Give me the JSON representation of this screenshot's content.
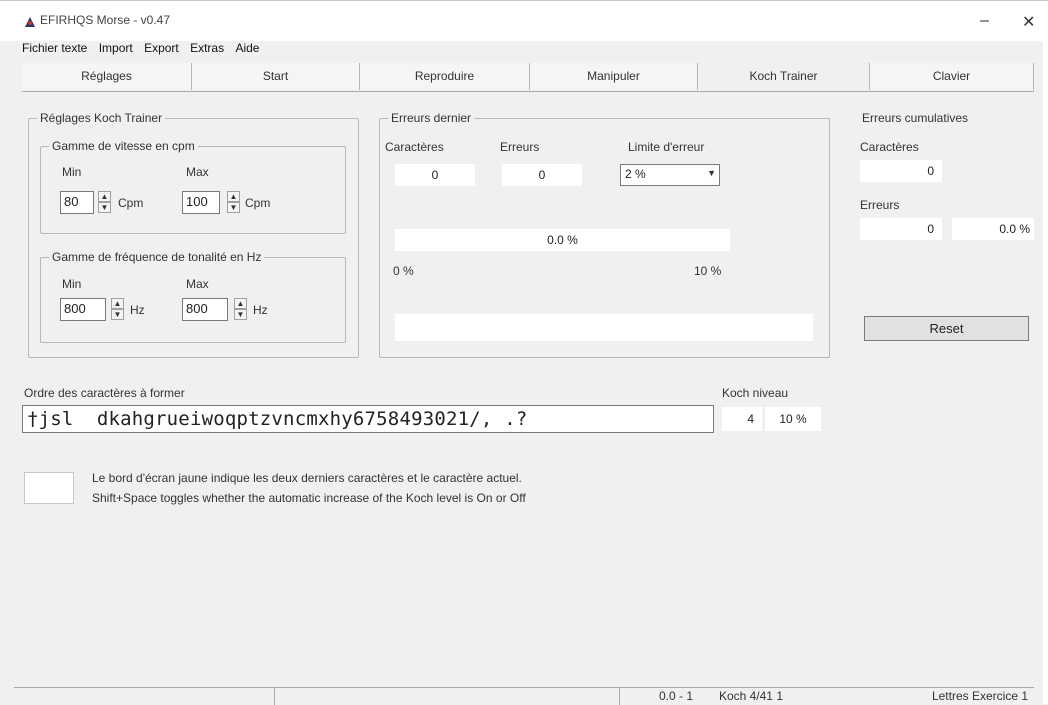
{
  "window": {
    "title": "EFIRHQS Morse - v0.47",
    "minimize": "‒",
    "close": "✕"
  },
  "menu": [
    "Fichier texte",
    "Import",
    "Export",
    "Extras",
    "Aide"
  ],
  "tabs": [
    "Réglages",
    "Start",
    "Reproduire",
    "Manipuler",
    "Koch Trainer",
    "Clavier"
  ],
  "koch_settings": {
    "title": "Réglages Koch Trainer",
    "speed_group": "Gamme de vitesse en cpm",
    "min_label": "Min",
    "max_label": "Max",
    "speed_min": "80",
    "speed_max": "100",
    "speed_unit": "Cpm",
    "freq_group": "Gamme de fréquence de tonalité en Hz",
    "freq_min": "800",
    "freq_max": "800",
    "freq_unit": "Hz"
  },
  "last_errors": {
    "title": "Erreurs dernier",
    "chars_label": "Caractères",
    "errors_label": "Erreurs",
    "limit_label": "Limite d'erreur",
    "chars_value": "0",
    "errors_value": "0",
    "limit_value": "2 %",
    "progress_text": "0.0 %",
    "scale_min": "0 %",
    "scale_max": "10 %"
  },
  "cumulative": {
    "title": "Erreurs cumulatives",
    "chars_label": "Caractères",
    "chars_value": "0",
    "errors_label": "Erreurs",
    "errors_value": "0",
    "errors_pct": "0.0 %",
    "reset": "Reset"
  },
  "order": {
    "label": "Ordre des caractères à former",
    "sequence": "†jsl  dkahgrueiwoqptzvncmxhy6758493021/, .?",
    "level_label": "Koch niveau",
    "level_value": "4",
    "level_pct": "10 %"
  },
  "hint": {
    "line1": "Le bord d'écran jaune indique les deux derniers caractères et le caractère actuel.",
    "line2": "Shift+Space toggles whether the automatic increase of the Koch level is On or Off"
  },
  "status": {
    "seg1": "",
    "seg2": "",
    "seg3": "0.0 - 1",
    "seg4": "Koch 4/41 1",
    "seg5": "Lettres Exercice 1"
  }
}
